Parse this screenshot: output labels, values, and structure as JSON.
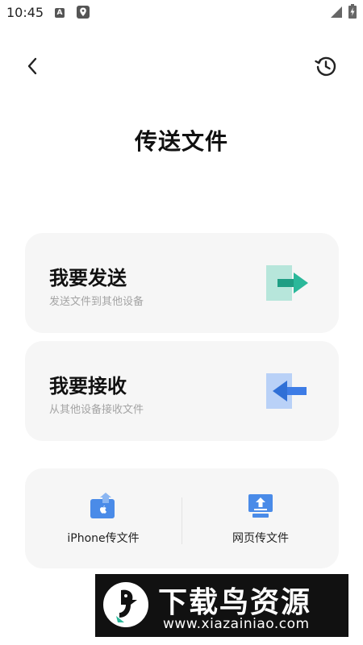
{
  "status_bar": {
    "time": "10:45",
    "a_badge": "A",
    "icons": [
      "a-badge-icon",
      "location-pin-icon",
      "signal-icon",
      "battery-charging-icon"
    ]
  },
  "nav": {
    "back_icon": "chevron-left-icon",
    "history_icon": "history-icon"
  },
  "page_title": "传送文件",
  "cards": {
    "send": {
      "title": "我要发送",
      "subtitle": "发送文件到其他设备",
      "icon": "send-arrow-right-icon",
      "accent": "#2bb89a",
      "accent_light": "#b7e6db"
    },
    "receive": {
      "title": "我要接收",
      "subtitle": "从其他设备接收文件",
      "icon": "receive-arrow-left-icon",
      "accent": "#3d7ce6",
      "accent_light": "#b9d1f7"
    }
  },
  "tools": {
    "iphone": {
      "label": "iPhone传文件",
      "icon": "iphone-transfer-icon"
    },
    "web": {
      "label": "网页传文件",
      "icon": "web-upload-icon"
    }
  },
  "watermark": {
    "title": "下载鸟资源",
    "url": "www.xiazainiao.com"
  },
  "colors": {
    "card_bg": "#f6f6f6",
    "subtitle_gray": "#a4a4a4",
    "tool_blue": "#4a8be8"
  }
}
